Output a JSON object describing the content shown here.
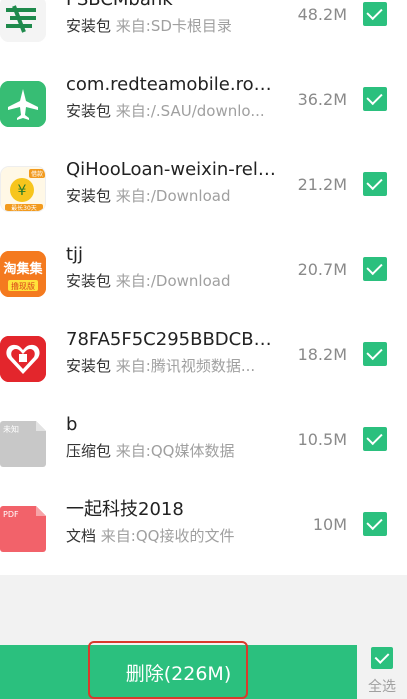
{
  "files": [
    {
      "icon": "psbc-bank-icon",
      "name": "PSBCMbank",
      "type": "安装包",
      "source": "来自:SD卡根目录",
      "size": "48.2M",
      "checked": true
    },
    {
      "icon": "airplane-app-icon",
      "name": "com.redteamobile.roa...",
      "type": "安装包",
      "source": "来自:/.SAU/downlo...",
      "size": "36.2M",
      "checked": true
    },
    {
      "icon": "qihoo-loan-icon",
      "name": "QiHooLoan-weixin-rele...",
      "type": "安装包",
      "source": "来自:/Download",
      "size": "21.2M",
      "checked": true
    },
    {
      "icon": "tjj-app-icon",
      "name": "tjj",
      "type": "安装包",
      "source": "来自:/Download",
      "size": "20.7M",
      "checked": true
    },
    {
      "icon": "pinduoduo-app-icon",
      "name": "78FA5F5C295BBDCBB...",
      "type": "安装包",
      "source": "来自:腾讯视频数据...",
      "size": "18.2M",
      "checked": true
    },
    {
      "icon": "unknown-file-icon",
      "name": "b",
      "type": "压缩包",
      "source": "来自:QQ媒体数据",
      "size": "10.5M",
      "checked": true
    },
    {
      "icon": "pdf-file-icon",
      "name": "一起科技2018",
      "type": "文档",
      "source": "来自:QQ接收的文件",
      "size": "10M",
      "checked": true
    }
  ],
  "icon_text": {
    "qihoo_badge": "借款",
    "qihoo_symbol": "¥",
    "qihoo_bottom": "最长30天",
    "tjj_main": "淘集集",
    "tjj_sub": "撸现版",
    "unknown": "未知",
    "pdf": "PDF"
  },
  "footer": {
    "delete_label": "删除(226M)",
    "select_all_label": "全选"
  },
  "colors": {
    "accent": "#2bc07e",
    "highlight": "#d93a2c"
  }
}
